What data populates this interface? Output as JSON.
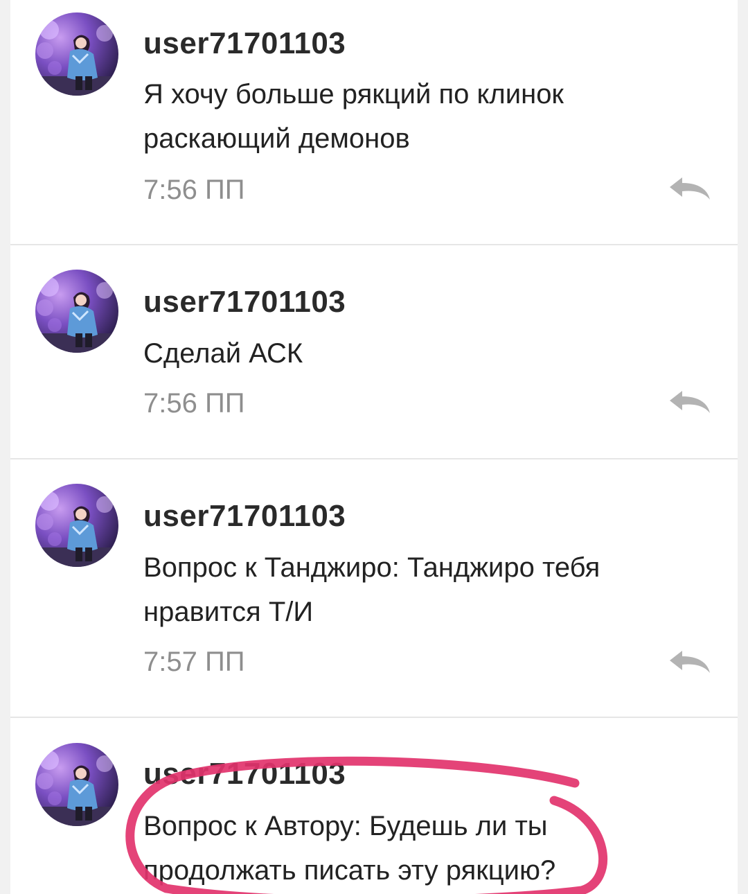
{
  "colors": {
    "username": "#2a2a2a",
    "text": "#222222",
    "time": "#8e8e8e",
    "reply_icon": "#b3b3b3",
    "divider": "#e6e6e6",
    "highlight_circle": "#e2336d"
  },
  "messages": [
    {
      "username": "user71701103",
      "text": "Я хочу больше рякций по клинок раскающий демонов",
      "time": "7:56 ПП",
      "reply_icon": "reply-arrow-icon"
    },
    {
      "username": "user71701103",
      "text": "Сделай АСК",
      "time": "7:56 ПП",
      "reply_icon": "reply-arrow-icon"
    },
    {
      "username": "user71701103",
      "text": "Вопрос к Танджиро: Танджиро тебя нравится Т/И",
      "time": "7:57 ПП",
      "reply_icon": "reply-arrow-icon"
    },
    {
      "username": "user71701103",
      "text": "Вопрос к Автору: Будешь ли ты продолжать писать эту рякцию?"
    }
  ]
}
